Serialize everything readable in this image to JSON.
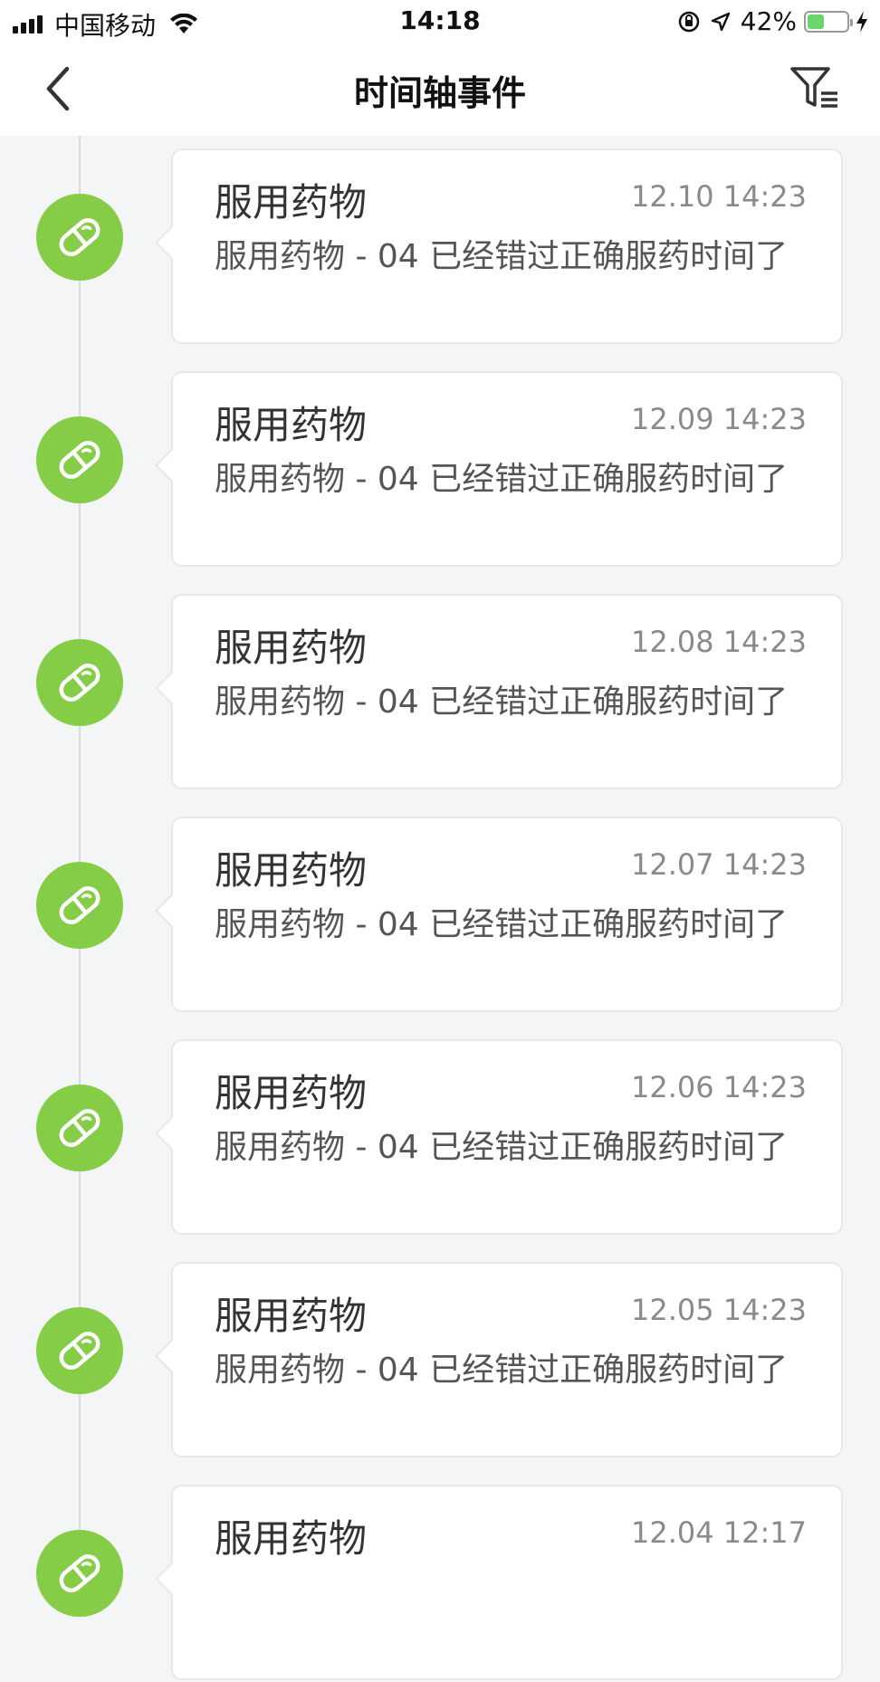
{
  "status_bar": {
    "carrier": "中国移动",
    "time": "14:18",
    "battery": "42%",
    "battery_level": 0.42,
    "battery_color": "#6cd56a"
  },
  "nav": {
    "title": "时间轴事件",
    "back_icon": "chevron-left-icon",
    "filter_icon": "filter-list-icon"
  },
  "accent_color": "#86cd47",
  "events": [
    {
      "title": "服用药物",
      "time": "12.10 14:23",
      "description": "服用药物 -  04 已经错过正确服药时间了",
      "icon": "pill-icon"
    },
    {
      "title": "服用药物",
      "time": "12.09 14:23",
      "description": "服用药物 -  04 已经错过正确服药时间了",
      "icon": "pill-icon"
    },
    {
      "title": "服用药物",
      "time": "12.08 14:23",
      "description": "服用药物 -  04 已经错过正确服药时间了",
      "icon": "pill-icon"
    },
    {
      "title": "服用药物",
      "time": "12.07 14:23",
      "description": "服用药物 -  04 已经错过正确服药时间了",
      "icon": "pill-icon"
    },
    {
      "title": "服用药物",
      "time": "12.06 14:23",
      "description": "服用药物 -  04 已经错过正确服药时间了",
      "icon": "pill-icon"
    },
    {
      "title": "服用药物",
      "time": "12.05 14:23",
      "description": "服用药物 -  04 已经错过正确服药时间了",
      "icon": "pill-icon"
    },
    {
      "title": "服用药物",
      "time": "12.04 12:17",
      "description": "",
      "icon": "pill-icon"
    }
  ]
}
